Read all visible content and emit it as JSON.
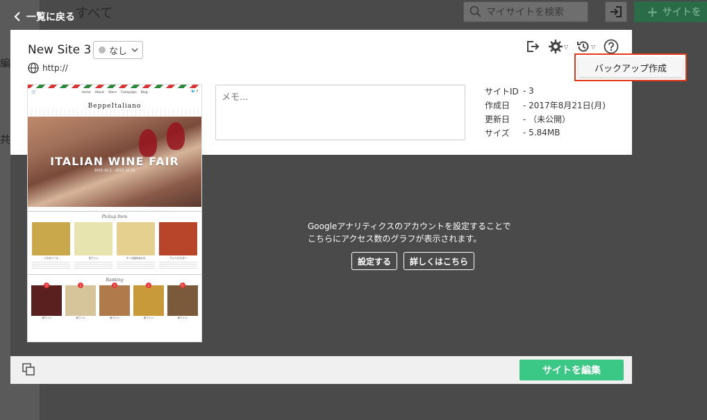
{
  "background": {
    "header_title": "すべて",
    "search_placeholder": "マイサイトを検索",
    "add_site_label": "サイトを",
    "sidebar_fragments": [
      "編",
      "共有"
    ]
  },
  "back_link": {
    "label": "一覧に戻る"
  },
  "site": {
    "title": "New Site 3",
    "status": "なし",
    "url": "http://"
  },
  "toolbar": {
    "icons": [
      "export-icon",
      "gear-icon",
      "history-icon",
      "help-icon"
    ]
  },
  "tooltip": {
    "label": "バックアップ作成",
    "highlight_color": "#e63a1c"
  },
  "memo": {
    "placeholder": "メモ..."
  },
  "info": [
    {
      "key": "サイトID",
      "value": "- 3"
    },
    {
      "key": "作成日",
      "value": "- 2017年8月21日(月)"
    },
    {
      "key": "更新日",
      "value": "- （未公開）"
    },
    {
      "key": "サイズ",
      "value": "- 5.84MB"
    }
  ],
  "thumbnail": {
    "nav": [
      "Home",
      "About",
      "Store",
      "Campaign",
      "Blog"
    ],
    "brand": "BeppeItaliano",
    "hero_title": "ITALIAN WINE FAIR",
    "hero_dates": "2015.10.1 - 2015.10.31",
    "pickup_heading": "Pickup Item",
    "products": [
      {
        "name": "パスタソース",
        "color": "#c8a84a"
      },
      {
        "name": "白ワイン",
        "color": "#e8e4b0"
      },
      {
        "name": "チーズ詰め合わせ",
        "color": "#e6d090"
      },
      {
        "name": "ワインビネガー",
        "color": "#b8442a"
      }
    ],
    "ranking_heading": "Ranking",
    "ranks": [
      {
        "num": "1",
        "name": "赤ワイン",
        "color": "#5a2020"
      },
      {
        "num": "2",
        "name": "赤ワイン",
        "color": "#d6c49a"
      },
      {
        "num": "3",
        "name": "赤ワイン",
        "color": "#b07a4a"
      },
      {
        "num": "4",
        "name": "赤ワイン",
        "color": "#c89a3a"
      },
      {
        "num": "5",
        "name": "赤ワイン",
        "color": "#7a5a3a"
      }
    ]
  },
  "analytics": {
    "message_line1": "Googleアナリティクスのアカウントを設定することで",
    "message_line2": "こちらにアクセス数のグラフが表示されます。",
    "setup_button": "設定する",
    "details_button": "詳しくはこちら"
  },
  "footer": {
    "edit_button": "サイトを編集",
    "accent_color": "#3bc785"
  }
}
